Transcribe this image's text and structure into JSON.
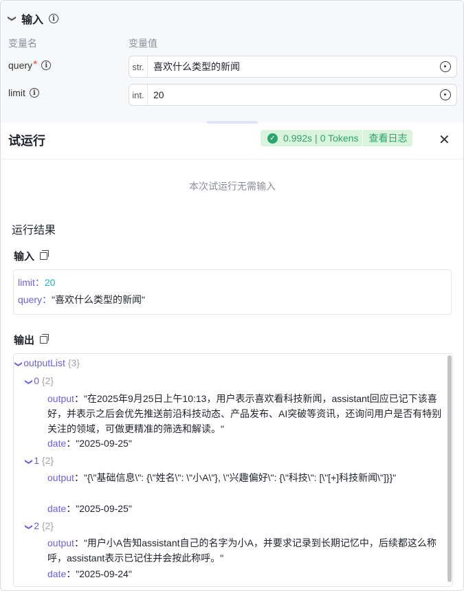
{
  "inputs": {
    "section_title": "输入",
    "col_name": "变量名",
    "col_value": "变量值",
    "variables": [
      {
        "name": "query",
        "required": "*",
        "type": "str.",
        "value": "喜欢什么类型的新闻"
      },
      {
        "name": "limit",
        "required": "",
        "type": "int.",
        "value": "20"
      }
    ]
  },
  "run_panel": {
    "title": "试运行",
    "status": {
      "duration": "0.992s",
      "separator": "|",
      "tokens": "0 Tokens",
      "log_label": "查看日志"
    },
    "close_icon": "close-icon",
    "no_input_text": "本次试运行无需输入",
    "result_title": "运行结果",
    "input_label": "输入",
    "output_label": "输出",
    "input_values": [
      {
        "key": "limit",
        "sep": "：",
        "value": "20"
      },
      {
        "key": "query",
        "sep": "：",
        "value": "\"喜欢什么类型的新闻\""
      }
    ],
    "output": {
      "root_key": "outputList",
      "root_count": "{3}",
      "items": [
        {
          "index": "0",
          "count": "{2}",
          "output_key": "output",
          "output_value": "\"在2025年9月25日上午10:13，用户表示喜欢看科技新闻，assistant回应已记下该喜好，并表示之后会优先推送前沿科技动态、产品发布、AI突破等资讯，还询问用户是否有特别关注的领域，可做更精准的筛选和解读。\"",
          "date_key": "date",
          "date_value": "\"2025-09-25\""
        },
        {
          "index": "1",
          "count": "{2}",
          "output_key": "output",
          "output_value": "\"{\\\"基础信息\\\": {\\\"姓名\\\": \\\"小A\\\"}, \\\"兴趣偏好\\\": {\\\"科技\\\": [\\\"[+]科技新闻\\\"]}}\"",
          "date_key": "date",
          "date_value": "\"2025-09-25\""
        },
        {
          "index": "2",
          "count": "{2}",
          "output_key": "output",
          "output_value": "\"用户小A告知assistant自己的名字为小A，并要求记录到长期记忆中，后续都这么称呼，assistant表示已记住并会按此称呼。\"",
          "date_key": "date",
          "date_value": "\"2025-09-24\""
        }
      ]
    }
  },
  "colors": {
    "key": "#6b5fe0",
    "number": "#1cb0c4",
    "success": "#2ba471",
    "success_bg": "#d9f3dd",
    "required": "#f53f3f"
  }
}
